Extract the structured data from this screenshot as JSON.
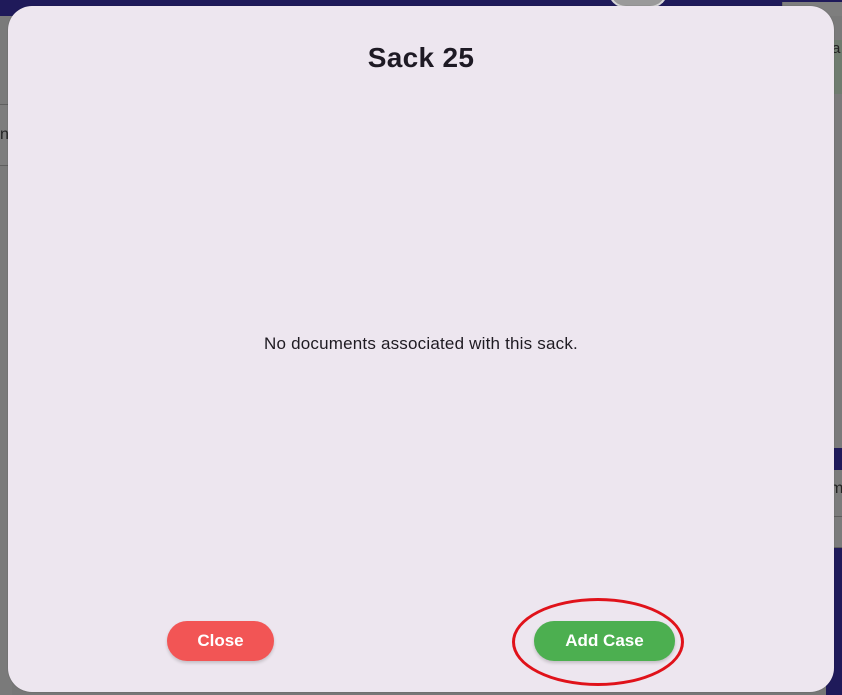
{
  "background": {
    "left_field_char": "n",
    "right_chars": [
      "a",
      "m"
    ],
    "colors": {
      "topbar": "#1f1a5a",
      "overlay": "#777777"
    }
  },
  "modal": {
    "title": "Sack 25",
    "message": "No documents associated with this sack.",
    "buttons": {
      "close_label": "Close",
      "add_case_label": "Add Case"
    },
    "colors": {
      "background": "#ede6ef",
      "close_button": "#f25555",
      "add_case_button": "#4caf50",
      "highlight": "#e0121a"
    }
  }
}
